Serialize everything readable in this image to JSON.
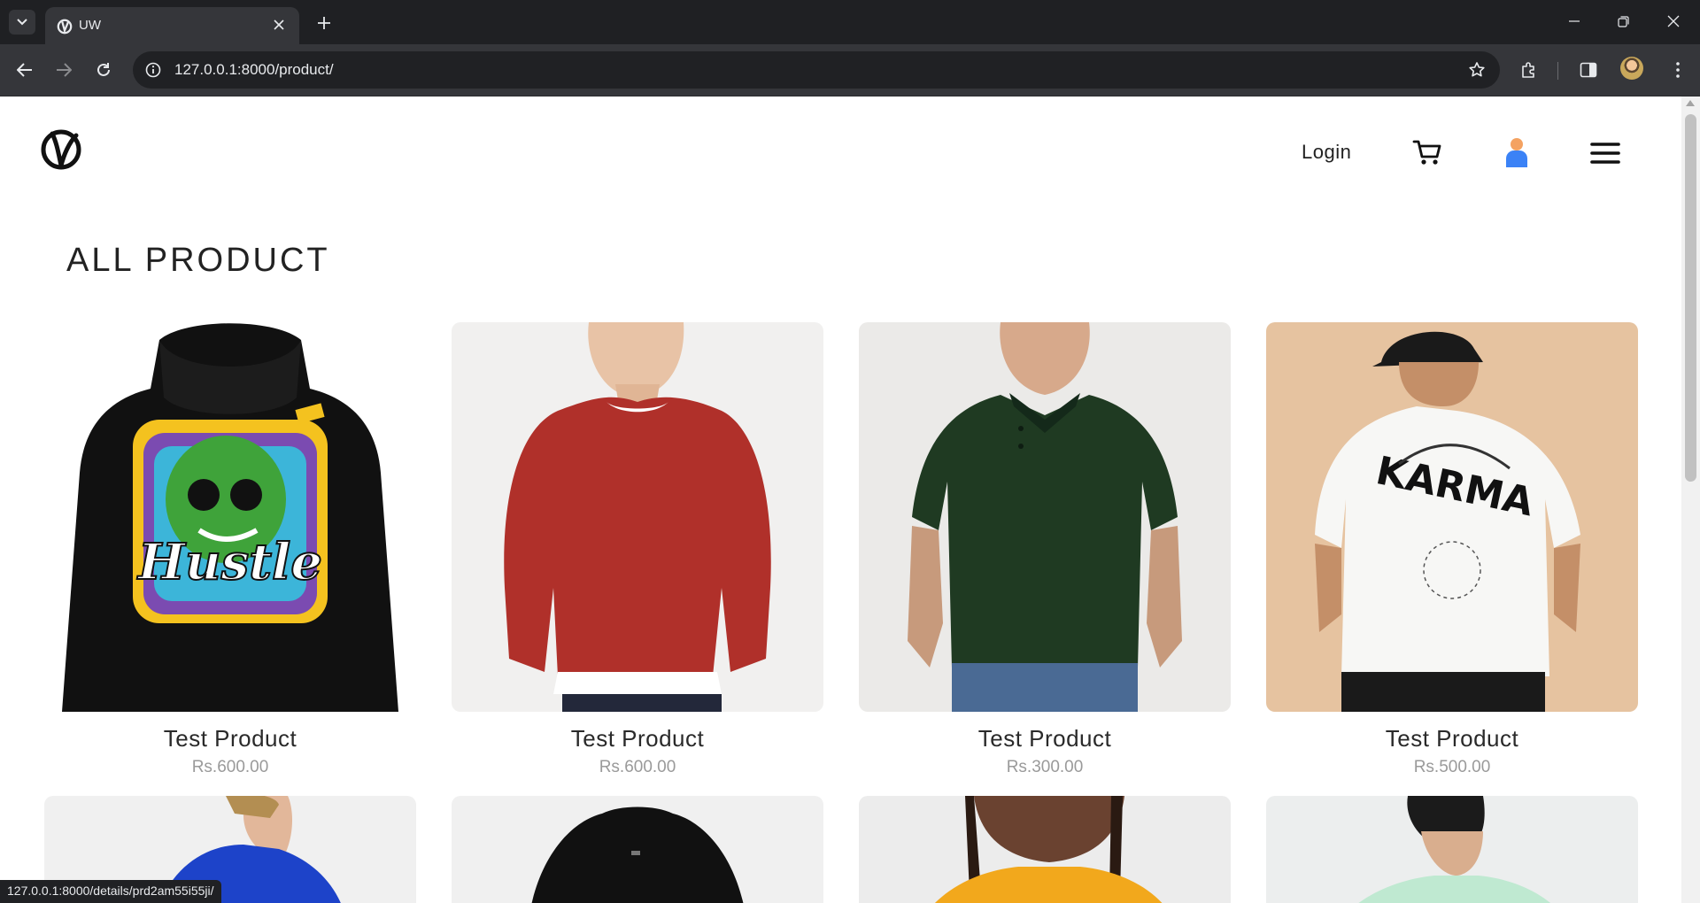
{
  "browser": {
    "tab_title": "UW",
    "url": "127.0.0.1:8000/product/",
    "status_url": "127.0.0.1:8000/details/prd2am55i55ji/"
  },
  "header": {
    "login_label": "Login"
  },
  "page": {
    "title": "ALL PRODUCT"
  },
  "products": [
    {
      "name": "Test Product",
      "price": "Rs.600.00",
      "image": "black-hoodie-hustle-print",
      "bg": "#ffffff"
    },
    {
      "name": "Test Product",
      "price": "Rs.600.00",
      "image": "red-sweatshirt",
      "bg": "#f1f0ef"
    },
    {
      "name": "Test Product",
      "price": "Rs.300.00",
      "image": "green-polo-shirt",
      "bg": "#ebeae8"
    },
    {
      "name": "Test Product",
      "price": "Rs.500.00",
      "image": "white-karma-tshirt",
      "bg": "#e6c3a0"
    },
    {
      "image": "blue-hoodie",
      "bg": "#f0f0f0"
    },
    {
      "image": "black-hoodie",
      "bg": "#f0f0f0"
    },
    {
      "image": "yellow-tshirt",
      "bg": "#ececec"
    },
    {
      "image": "mint-tshirt",
      "bg": "#eceeee"
    }
  ],
  "colors": {
    "chrome_dark": "#1f2023",
    "chrome_toolbar": "#35363a",
    "price_gray": "#9a9a9a",
    "user_icon_body": "#3b82f6",
    "user_icon_head": "#f4a261"
  }
}
